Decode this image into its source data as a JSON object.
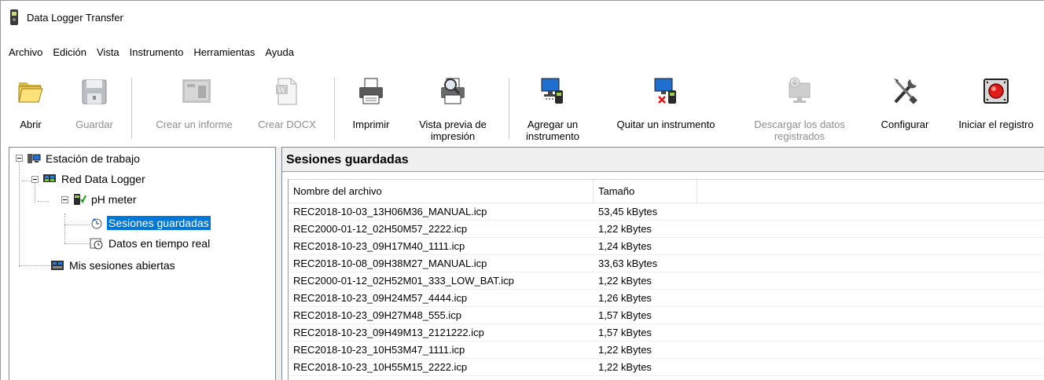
{
  "window": {
    "title": "Data Logger Transfer"
  },
  "menu": [
    "Archivo",
    "Edición",
    "Vista",
    "Instrumento",
    "Herramientas",
    "Ayuda"
  ],
  "toolbar": {
    "open": "Abrir",
    "save": "Guardar",
    "report": "Crear un informe",
    "docx": "Crear DOCX",
    "print": "Imprimir",
    "preview_1": "Vista previa de",
    "preview_2": "impresión",
    "add_1": "Agregar un",
    "add_2": "instrumento",
    "remove": "Quitar un instrumento",
    "download_1": "Descargar los datos",
    "download_2": "registrados",
    "configure": "Configurar",
    "start": "Iniciar el registro"
  },
  "tree": {
    "workstation": "Estación de trabajo",
    "network": "Red Data Logger",
    "instrument": "pH meter",
    "saved_sessions": "Sesiones guardadas",
    "realtime": "Datos en tiempo real",
    "open_sessions": "Mis sesiones abiertas"
  },
  "panel": {
    "title": "Sesiones guardadas",
    "columns": {
      "name": "Nombre del archivo",
      "size": "Tamaño"
    },
    "rows": [
      {
        "name": "REC2018-10-03_13H06M36_MANUAL.icp",
        "size": "53,45 kBytes"
      },
      {
        "name": "REC2000-01-12_02H50M57_2222.icp",
        "size": "1,22 kBytes"
      },
      {
        "name": "REC2018-10-23_09H17M40_1111.icp",
        "size": "1,24 kBytes"
      },
      {
        "name": "REC2018-10-08_09H38M27_MANUAL.icp",
        "size": "33,63 kBytes"
      },
      {
        "name": "REC2000-01-12_02H52M01_333_LOW_BAT.icp",
        "size": "1,22 kBytes"
      },
      {
        "name": "REC2018-10-23_09H24M57_4444.icp",
        "size": "1,26 kBytes"
      },
      {
        "name": "REC2018-10-23_09H27M48_555.icp",
        "size": "1,57 kBytes"
      },
      {
        "name": "REC2018-10-23_09H49M13_2121222.icp",
        "size": "1,57 kBytes"
      },
      {
        "name": "REC2018-10-23_10H53M47_1111.icp",
        "size": "1,22 kBytes"
      },
      {
        "name": "REC2018-10-23_10H55M15_2222.icp",
        "size": "1,22 kBytes"
      }
    ]
  },
  "colors": {
    "selection": "#0078d7",
    "disabled_text": "#8e8e8e"
  }
}
